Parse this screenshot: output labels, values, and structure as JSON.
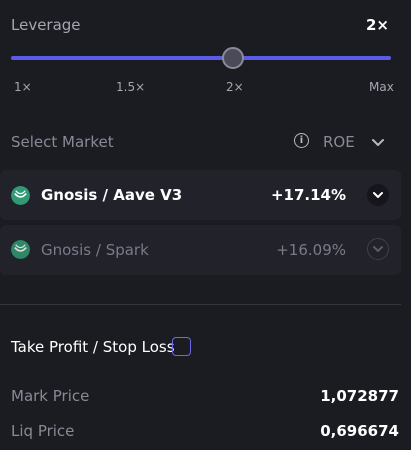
{
  "leverage": {
    "title": "Leverage",
    "value": "2×",
    "slider_position": 0.585,
    "ticks": [
      "1×",
      "1.5×",
      "2×",
      "Max"
    ]
  },
  "market": {
    "title": "Select Market",
    "sort_label": "ROE",
    "items": [
      {
        "name": "Gnosis / Aave V3",
        "roe": "+17.14%",
        "selected": true
      },
      {
        "name": "Gnosis / Spark",
        "roe": "+16.09%",
        "selected": false
      }
    ]
  },
  "tpsl": {
    "label": "Take Profit / Stop Loss",
    "checked": false
  },
  "prices": {
    "mark_label": "Mark Price",
    "mark_value": "1,072877",
    "liq_label": "Liq Price",
    "liq_value": "0,696674"
  },
  "colors": {
    "background": "#1b1b22",
    "card": "#22222b",
    "accent": "#5b5be6",
    "gnosis_green": "#2f9a73"
  },
  "icons": {
    "info": "info-icon",
    "chevron": "chevron-down-icon",
    "market": "gnosis-logo-icon"
  }
}
